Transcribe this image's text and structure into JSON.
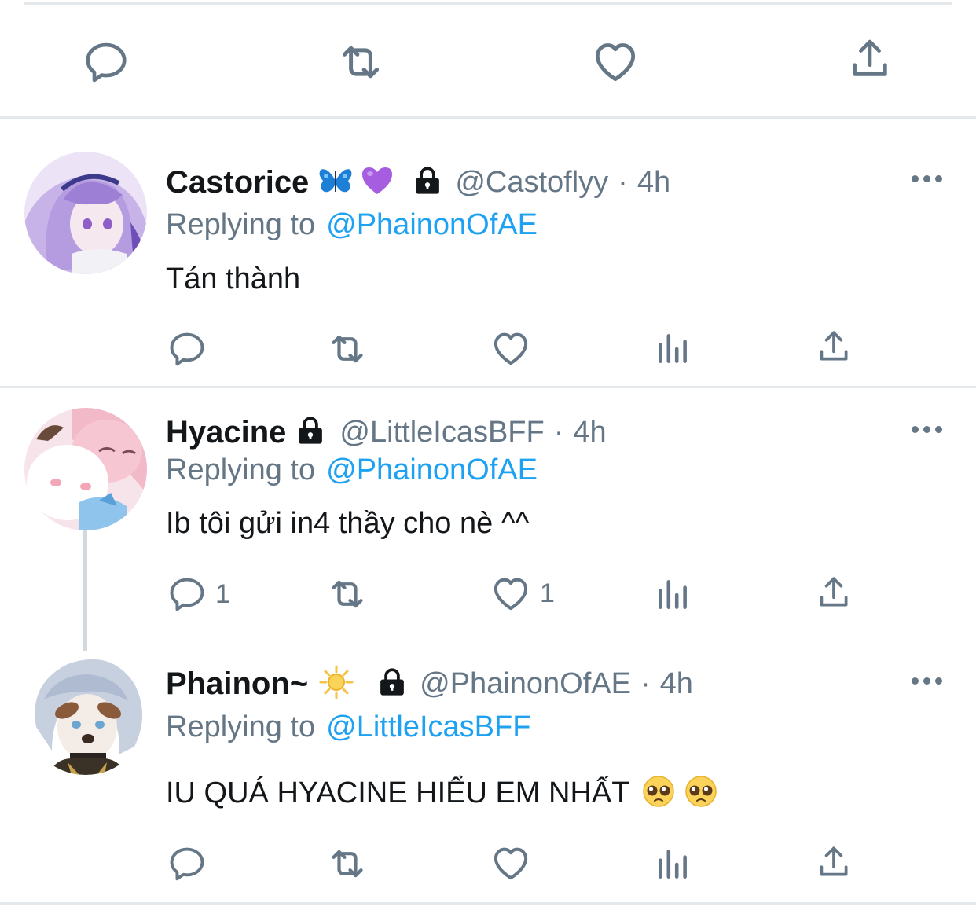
{
  "tweets": [
    {
      "name": "Castorice",
      "handle": "@Castoflyy",
      "separator": "·",
      "time": "4h",
      "replying_prefix": "Replying to",
      "replying_to": "@PhainonOfAE",
      "text": "Tán thành",
      "reply_count": "",
      "like_count": "",
      "emojis": [
        "butterfly",
        "purple-heart"
      ]
    },
    {
      "name": "Hyacine",
      "handle": "@LittleIcasBFF",
      "separator": "·",
      "time": "4h",
      "replying_prefix": "Replying to",
      "replying_to": "@PhainonOfAE",
      "text": "Ib tôi gửi in4 thầy cho nè ^^",
      "reply_count": "1",
      "like_count": "1"
    },
    {
      "name": "Phainon~",
      "handle": "@PhainonOfAE",
      "separator": "·",
      "time": "4h",
      "replying_prefix": "Replying to",
      "replying_to": "@LittleIcasBFF",
      "text": "IU QUÁ HYACINE HIỂU EM NHẤT",
      "reply_count": "",
      "like_count": "",
      "emojis": [
        "sun",
        "pleading-face",
        "pleading-face"
      ]
    }
  ],
  "colors": {
    "accent": "#1da1f2",
    "secondary_text": "#657786",
    "divider": "#e6e9ec"
  },
  "icons": [
    "reply-icon",
    "retweet-icon",
    "like-icon",
    "share-icon",
    "analytics-icon",
    "lock-icon",
    "more-icon"
  ]
}
